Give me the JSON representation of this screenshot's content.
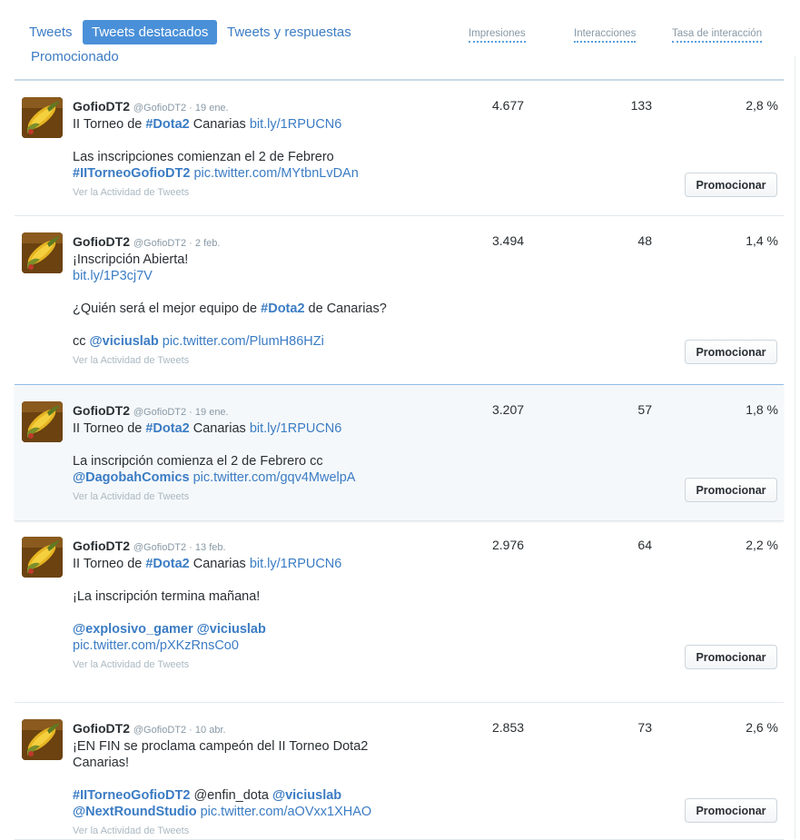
{
  "tabs": [
    {
      "label": "Tweets",
      "active": false
    },
    {
      "label": "Tweets destacados",
      "active": true
    },
    {
      "label": "Tweets y respuestas",
      "active": false
    },
    {
      "label": "Promocionado",
      "active": false
    }
  ],
  "columns": {
    "impressions": "Impresiones",
    "interactions": "Interacciones",
    "rate": "Tasa de interacción"
  },
  "colors": {
    "accent": "#3b7cc4",
    "active_tab": "#4a90d9",
    "highlight_row": "#f5f8fa"
  },
  "tweets": [
    {
      "name": "GofioDT2",
      "handle": "@GofioDT2 · 19 ene.",
      "lines": [
        [
          {
            "t": "text",
            "v": "II Torneo de "
          },
          {
            "t": "hashtag",
            "v": "#Dota2"
          },
          {
            "t": "text",
            "v": " Canarias "
          },
          {
            "t": "link",
            "v": "bit.ly/1RPUCN6"
          }
        ],
        [],
        [
          {
            "t": "text",
            "v": "Las inscripciones comienzan el 2 de Febrero"
          }
        ],
        [
          {
            "t": "hashtag",
            "v": "#IITorneoGofioDT2"
          },
          {
            "t": "text",
            "v": " "
          },
          {
            "t": "link",
            "v": "pic.twitter.com/MYtbnLvDAn"
          }
        ]
      ],
      "activity": "Ver la Actividad de Tweets",
      "impressions": "4.677",
      "interactions": "133",
      "rate": "2,8 %",
      "promote": "Promocionar"
    },
    {
      "name": "GofioDT2",
      "handle": "@GofioDT2 · 2 feb.",
      "lines": [
        [
          {
            "t": "text",
            "v": "¡Inscripción Abierta!"
          }
        ],
        [
          {
            "t": "link",
            "v": "bit.ly/1P3cj7V"
          }
        ],
        [],
        [
          {
            "t": "text",
            "v": "¿Quién será el mejor equipo de "
          },
          {
            "t": "hashtag",
            "v": "#Dota2"
          },
          {
            "t": "text",
            "v": " de Canarias?"
          }
        ],
        [],
        [
          {
            "t": "text",
            "v": "cc "
          },
          {
            "t": "mention",
            "v": "@viciuslab"
          },
          {
            "t": "text",
            "v": " "
          },
          {
            "t": "link",
            "v": "pic.twitter.com/PlumH86HZi"
          }
        ]
      ],
      "activity": "Ver la Actividad de Tweets",
      "impressions": "3.494",
      "interactions": "48",
      "rate": "1,4 %",
      "promote": "Promocionar"
    },
    {
      "name": "GofioDT2",
      "handle": "@GofioDT2 · 19 ene.",
      "lines": [
        [
          {
            "t": "text",
            "v": "II Torneo de "
          },
          {
            "t": "hashtag",
            "v": "#Dota2"
          },
          {
            "t": "text",
            "v": " Canarias "
          },
          {
            "t": "link",
            "v": "bit.ly/1RPUCN6"
          }
        ],
        [],
        [
          {
            "t": "text",
            "v": "La inscripción comienza el 2 de Febrero cc"
          }
        ],
        [
          {
            "t": "mention",
            "v": "@DagobahComics"
          },
          {
            "t": "text",
            "v": " "
          },
          {
            "t": "link",
            "v": "pic.twitter.com/gqv4MwelpA"
          }
        ]
      ],
      "activity": "Ver la Actividad de Tweets",
      "impressions": "3.207",
      "interactions": "57",
      "rate": "1,8 %",
      "promote": "Promocionar"
    },
    {
      "name": "GofioDT2",
      "handle": "@GofioDT2 · 13 feb.",
      "lines": [
        [
          {
            "t": "text",
            "v": "II Torneo de "
          },
          {
            "t": "hashtag",
            "v": "#Dota2"
          },
          {
            "t": "text",
            "v": " Canarias "
          },
          {
            "t": "link",
            "v": "bit.ly/1RPUCN6"
          }
        ],
        [],
        [
          {
            "t": "text",
            "v": "¡La inscripción termina mañana!"
          }
        ],
        [],
        [
          {
            "t": "mention",
            "v": "@explosivo_gamer"
          },
          {
            "t": "text",
            "v": "  "
          },
          {
            "t": "mention",
            "v": "@viciuslab"
          }
        ],
        [
          {
            "t": "link",
            "v": "pic.twitter.com/pXKzRnsCo0"
          }
        ]
      ],
      "activity": "Ver la Actividad de Tweets",
      "impressions": "2.976",
      "interactions": "64",
      "rate": "2,2 %",
      "promote": "Promocionar"
    },
    {
      "name": "GofioDT2",
      "handle": "@GofioDT2 · 10 abr.",
      "lines": [
        [
          {
            "t": "text",
            "v": "¡EN FIN se proclama campeón del II Torneo Dota2"
          }
        ],
        [
          {
            "t": "text",
            "v": "Canarias!"
          }
        ],
        [],
        [
          {
            "t": "hashtag",
            "v": "#IITorneoGofioDT2"
          },
          {
            "t": "text",
            "v": " @enfin_dota "
          },
          {
            "t": "mention",
            "v": "@viciuslab"
          }
        ],
        [
          {
            "t": "mention",
            "v": "@NextRoundStudio"
          },
          {
            "t": "text",
            "v": " "
          },
          {
            "t": "link",
            "v": "pic.twitter.com/aOVxx1XHAO"
          }
        ]
      ],
      "activity": "Ver la Actividad de Tweets",
      "impressions": "2.853",
      "interactions": "73",
      "rate": "2,6 %",
      "promote": "Promocionar"
    }
  ]
}
